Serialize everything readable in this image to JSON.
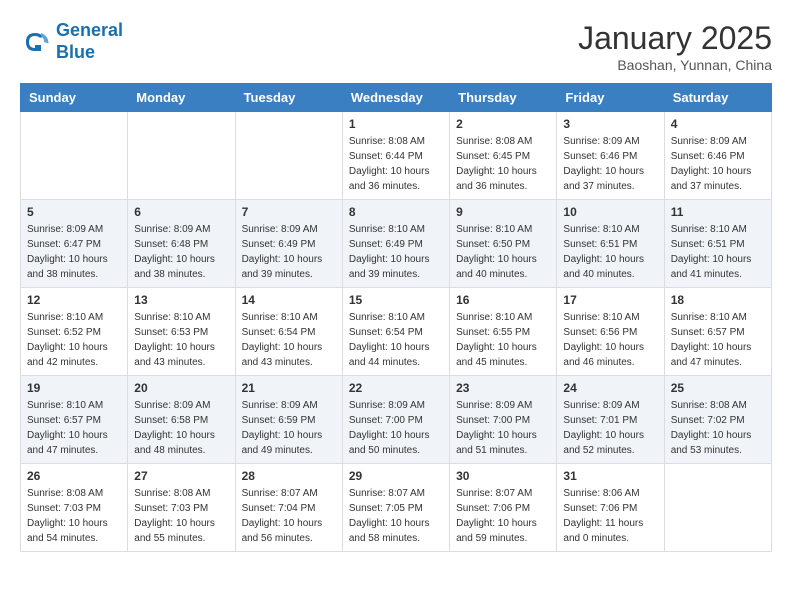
{
  "header": {
    "logo_line1": "General",
    "logo_line2": "Blue",
    "month": "January 2025",
    "location": "Baoshan, Yunnan, China"
  },
  "weekdays": [
    "Sunday",
    "Monday",
    "Tuesday",
    "Wednesday",
    "Thursday",
    "Friday",
    "Saturday"
  ],
  "weeks": [
    [
      {
        "day": "",
        "info": ""
      },
      {
        "day": "",
        "info": ""
      },
      {
        "day": "",
        "info": ""
      },
      {
        "day": "1",
        "info": "Sunrise: 8:08 AM\nSunset: 6:44 PM\nDaylight: 10 hours\nand 36 minutes."
      },
      {
        "day": "2",
        "info": "Sunrise: 8:08 AM\nSunset: 6:45 PM\nDaylight: 10 hours\nand 36 minutes."
      },
      {
        "day": "3",
        "info": "Sunrise: 8:09 AM\nSunset: 6:46 PM\nDaylight: 10 hours\nand 37 minutes."
      },
      {
        "day": "4",
        "info": "Sunrise: 8:09 AM\nSunset: 6:46 PM\nDaylight: 10 hours\nand 37 minutes."
      }
    ],
    [
      {
        "day": "5",
        "info": "Sunrise: 8:09 AM\nSunset: 6:47 PM\nDaylight: 10 hours\nand 38 minutes."
      },
      {
        "day": "6",
        "info": "Sunrise: 8:09 AM\nSunset: 6:48 PM\nDaylight: 10 hours\nand 38 minutes."
      },
      {
        "day": "7",
        "info": "Sunrise: 8:09 AM\nSunset: 6:49 PM\nDaylight: 10 hours\nand 39 minutes."
      },
      {
        "day": "8",
        "info": "Sunrise: 8:10 AM\nSunset: 6:49 PM\nDaylight: 10 hours\nand 39 minutes."
      },
      {
        "day": "9",
        "info": "Sunrise: 8:10 AM\nSunset: 6:50 PM\nDaylight: 10 hours\nand 40 minutes."
      },
      {
        "day": "10",
        "info": "Sunrise: 8:10 AM\nSunset: 6:51 PM\nDaylight: 10 hours\nand 40 minutes."
      },
      {
        "day": "11",
        "info": "Sunrise: 8:10 AM\nSunset: 6:51 PM\nDaylight: 10 hours\nand 41 minutes."
      }
    ],
    [
      {
        "day": "12",
        "info": "Sunrise: 8:10 AM\nSunset: 6:52 PM\nDaylight: 10 hours\nand 42 minutes."
      },
      {
        "day": "13",
        "info": "Sunrise: 8:10 AM\nSunset: 6:53 PM\nDaylight: 10 hours\nand 43 minutes."
      },
      {
        "day": "14",
        "info": "Sunrise: 8:10 AM\nSunset: 6:54 PM\nDaylight: 10 hours\nand 43 minutes."
      },
      {
        "day": "15",
        "info": "Sunrise: 8:10 AM\nSunset: 6:54 PM\nDaylight: 10 hours\nand 44 minutes."
      },
      {
        "day": "16",
        "info": "Sunrise: 8:10 AM\nSunset: 6:55 PM\nDaylight: 10 hours\nand 45 minutes."
      },
      {
        "day": "17",
        "info": "Sunrise: 8:10 AM\nSunset: 6:56 PM\nDaylight: 10 hours\nand 46 minutes."
      },
      {
        "day": "18",
        "info": "Sunrise: 8:10 AM\nSunset: 6:57 PM\nDaylight: 10 hours\nand 47 minutes."
      }
    ],
    [
      {
        "day": "19",
        "info": "Sunrise: 8:10 AM\nSunset: 6:57 PM\nDaylight: 10 hours\nand 47 minutes."
      },
      {
        "day": "20",
        "info": "Sunrise: 8:09 AM\nSunset: 6:58 PM\nDaylight: 10 hours\nand 48 minutes."
      },
      {
        "day": "21",
        "info": "Sunrise: 8:09 AM\nSunset: 6:59 PM\nDaylight: 10 hours\nand 49 minutes."
      },
      {
        "day": "22",
        "info": "Sunrise: 8:09 AM\nSunset: 7:00 PM\nDaylight: 10 hours\nand 50 minutes."
      },
      {
        "day": "23",
        "info": "Sunrise: 8:09 AM\nSunset: 7:00 PM\nDaylight: 10 hours\nand 51 minutes."
      },
      {
        "day": "24",
        "info": "Sunrise: 8:09 AM\nSunset: 7:01 PM\nDaylight: 10 hours\nand 52 minutes."
      },
      {
        "day": "25",
        "info": "Sunrise: 8:08 AM\nSunset: 7:02 PM\nDaylight: 10 hours\nand 53 minutes."
      }
    ],
    [
      {
        "day": "26",
        "info": "Sunrise: 8:08 AM\nSunset: 7:03 PM\nDaylight: 10 hours\nand 54 minutes."
      },
      {
        "day": "27",
        "info": "Sunrise: 8:08 AM\nSunset: 7:03 PM\nDaylight: 10 hours\nand 55 minutes."
      },
      {
        "day": "28",
        "info": "Sunrise: 8:07 AM\nSunset: 7:04 PM\nDaylight: 10 hours\nand 56 minutes."
      },
      {
        "day": "29",
        "info": "Sunrise: 8:07 AM\nSunset: 7:05 PM\nDaylight: 10 hours\nand 58 minutes."
      },
      {
        "day": "30",
        "info": "Sunrise: 8:07 AM\nSunset: 7:06 PM\nDaylight: 10 hours\nand 59 minutes."
      },
      {
        "day": "31",
        "info": "Sunrise: 8:06 AM\nSunset: 7:06 PM\nDaylight: 11 hours\nand 0 minutes."
      },
      {
        "day": "",
        "info": ""
      }
    ]
  ]
}
